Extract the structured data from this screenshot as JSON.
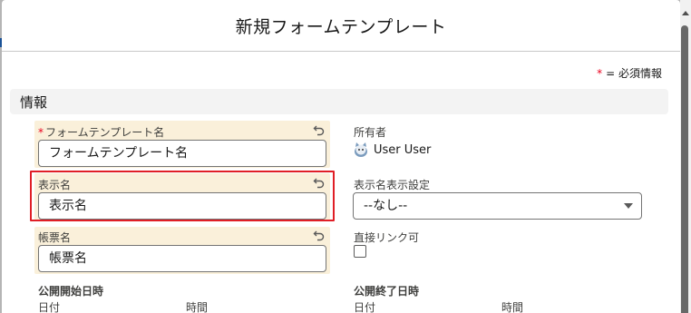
{
  "modal": {
    "title": "新規フォームテンプレート"
  },
  "required_note": {
    "star": "*",
    "text": "= 必須情報"
  },
  "section": {
    "title": "情報"
  },
  "fields": {
    "form_template_name": {
      "required_mark": "*",
      "label": "フォームテンプレート名",
      "value": "フォームテンプレート名"
    },
    "display_name": {
      "label": "表示名",
      "value": "表示名"
    },
    "form_name": {
      "label": "帳票名",
      "value": "帳票名"
    },
    "owner": {
      "label": "所有者",
      "value": "User User"
    },
    "display_name_setting": {
      "label": "表示名表示設定",
      "selected": "--なし--"
    },
    "direct_link": {
      "label": "直接リンク可",
      "checked": false
    },
    "publish_start": {
      "label": "公開開始日時",
      "date_label": "日付",
      "time_label": "時間"
    },
    "publish_end": {
      "label": "公開終了日時",
      "date_label": "日付",
      "time_label": "時間"
    }
  },
  "colors": {
    "highlight": "#e01e26",
    "edited_field_bg": "#faf0da",
    "required": "#ea001e"
  },
  "icons": {
    "undo": "undo-icon",
    "avatar": "user-avatar-icon",
    "caret": "chevron-down-icon"
  }
}
